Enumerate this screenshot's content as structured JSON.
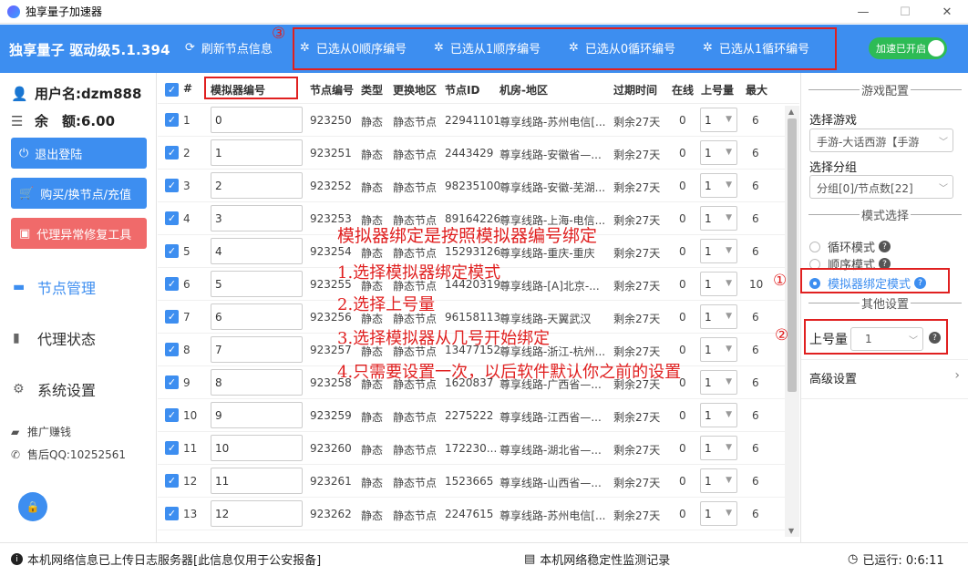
{
  "window": {
    "title": "独享量子加速器",
    "minimize": "—",
    "maximize": "☐",
    "close": "✕"
  },
  "header": {
    "brand": "独享量子 驱动级5.1.394",
    "refresh": "刷新节点信息",
    "actions": [
      "已选从0顺序编号",
      "已选从1顺序编号",
      "已选从0循环编号",
      "已选从1循环编号"
    ],
    "toggle": "加速已开启"
  },
  "sidebar": {
    "username": "用户名:dzm888",
    "balance": "余　额:6.00",
    "logout": "退出登陆",
    "buy": "购买/换节点/充值",
    "repair": "代理异常修复工具",
    "nav": [
      "节点管理",
      "代理状态",
      "系统设置"
    ],
    "promote": "推广赚钱",
    "support": "售后QQ:10252561"
  },
  "table": {
    "headers": [
      "#",
      "模拟器编号",
      "节点编号",
      "类型",
      "更换地区",
      "节点ID",
      "机房-地区",
      "过期时间",
      "在线",
      "上号量",
      "最大"
    ],
    "rows": [
      {
        "idx": "1",
        "emu": "0",
        "node": "923250",
        "type": "静态",
        "region": "静态节点",
        "nid": "22941101",
        "room": "尊享线路-苏州电信[...",
        "expire": "剩余27天",
        "online": "0",
        "acct": "1",
        "max": "6"
      },
      {
        "idx": "2",
        "emu": "1",
        "node": "923251",
        "type": "静态",
        "region": "静态节点",
        "nid": "2443429",
        "room": "尊享线路-安徽省—...",
        "expire": "剩余27天",
        "online": "0",
        "acct": "1",
        "max": "6"
      },
      {
        "idx": "3",
        "emu": "2",
        "node": "923252",
        "type": "静态",
        "region": "静态节点",
        "nid": "98235100",
        "room": "尊享线路-安徽-芜湖...",
        "expire": "剩余27天",
        "online": "0",
        "acct": "1",
        "max": "6"
      },
      {
        "idx": "4",
        "emu": "3",
        "node": "923253",
        "type": "静态",
        "region": "静态节点",
        "nid": "89164226",
        "room": "尊享线路-上海-电信...",
        "expire": "剩余27天",
        "online": "0",
        "acct": "1",
        "max": "6"
      },
      {
        "idx": "5",
        "emu": "4",
        "node": "923254",
        "type": "静态",
        "region": "静态节点",
        "nid": "15293126",
        "room": "尊享线路-重庆-重庆",
        "expire": "剩余27天",
        "online": "0",
        "acct": "1",
        "max": "6"
      },
      {
        "idx": "6",
        "emu": "5",
        "node": "923255",
        "type": "静态",
        "region": "静态节点",
        "nid": "14420319",
        "room": "尊享线路-[A]北京-...",
        "expire": "剩余27天",
        "online": "0",
        "acct": "1",
        "max": "10"
      },
      {
        "idx": "7",
        "emu": "6",
        "node": "923256",
        "type": "静态",
        "region": "静态节点",
        "nid": "96158113",
        "room": "尊享线路-天翼武汉",
        "expire": "剩余27天",
        "online": "0",
        "acct": "1",
        "max": "6"
      },
      {
        "idx": "8",
        "emu": "7",
        "node": "923257",
        "type": "静态",
        "region": "静态节点",
        "nid": "13477152",
        "room": "尊享线路-浙江-杭州...",
        "expire": "剩余27天",
        "online": "0",
        "acct": "1",
        "max": "6"
      },
      {
        "idx": "9",
        "emu": "8",
        "node": "923258",
        "type": "静态",
        "region": "静态节点",
        "nid": "1620837",
        "room": "尊享线路-广西省—...",
        "expire": "剩余27天",
        "online": "0",
        "acct": "1",
        "max": "6"
      },
      {
        "idx": "10",
        "emu": "9",
        "node": "923259",
        "type": "静态",
        "region": "静态节点",
        "nid": "2275222",
        "room": "尊享线路-江西省—...",
        "expire": "剩余27天",
        "online": "0",
        "acct": "1",
        "max": "6"
      },
      {
        "idx": "11",
        "emu": "10",
        "node": "923260",
        "type": "静态",
        "region": "静态节点",
        "nid": "172230...",
        "room": "尊享线路-湖北省—...",
        "expire": "剩余27天",
        "online": "0",
        "acct": "1",
        "max": "6"
      },
      {
        "idx": "12",
        "emu": "11",
        "node": "923261",
        "type": "静态",
        "region": "静态节点",
        "nid": "1523665",
        "room": "尊享线路-山西省—...",
        "expire": "剩余27天",
        "online": "0",
        "acct": "1",
        "max": "6"
      },
      {
        "idx": "13",
        "emu": "12",
        "node": "923262",
        "type": "静态",
        "region": "静态节点",
        "nid": "2247615",
        "room": "尊享线路-苏州电信[...",
        "expire": "剩余27天",
        "online": "0",
        "acct": "1",
        "max": "6"
      }
    ]
  },
  "overlay": {
    "title": "模拟器绑定是按照模拟器编号绑定",
    "steps": [
      "1.选择模拟器绑定模式",
      "2.选择上号量",
      "3.选择模拟器从几号开始绑定",
      "4.只需要设置一次，以后软件默认你之前的设置"
    ],
    "markers": [
      "③",
      "①",
      "②"
    ]
  },
  "right": {
    "game_config": "游戏配置",
    "select_game": "选择游戏",
    "game_value": "手游-大话西游【手游",
    "select_group": "选择分组",
    "group_value": "分组[0]/节点数[22]",
    "mode_select": "模式选择",
    "modes": [
      "循环模式",
      "顺序模式",
      "模拟器绑定模式"
    ],
    "other": "其他设置",
    "acct_label": "上号量",
    "acct_value": "1",
    "advanced": "高级设置"
  },
  "footer": {
    "info": "本机网络信息已上传日志服务器[此信息仅用于公安报备]",
    "monitor": "本机网络稳定性监测记录",
    "runtime": "已运行:  0:6:11"
  }
}
